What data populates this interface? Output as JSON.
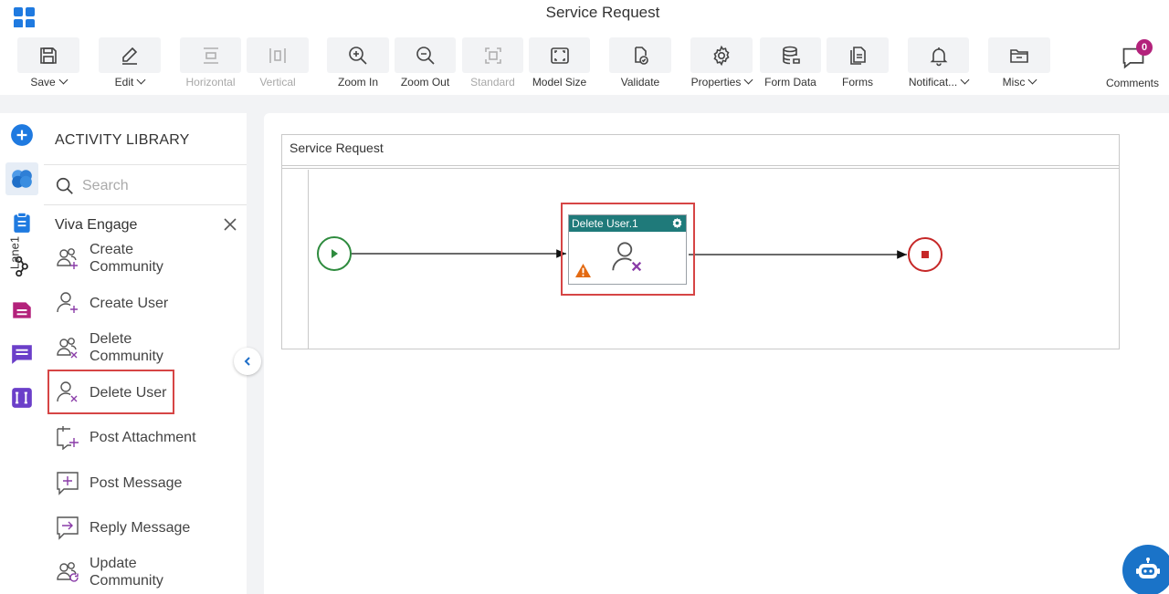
{
  "app": {
    "title": "Service Request"
  },
  "toolbar": {
    "save": "Save",
    "edit": "Edit",
    "horizontal": "Horizontal",
    "vertical": "Vertical",
    "zoom_in": "Zoom In",
    "zoom_out": "Zoom Out",
    "standard": "Standard",
    "model_size": "Model Size",
    "validate": "Validate",
    "properties": "Properties",
    "form_data": "Form Data",
    "forms": "Forms",
    "notifications": "Notificat...",
    "misc": "Misc",
    "comments": "Comments",
    "comments_count": "0"
  },
  "rail": {
    "icons": [
      "add-icon",
      "activity-library-icon",
      "clipboard-icon",
      "integration-icon",
      "form-icon",
      "message-icon",
      "text-icon"
    ]
  },
  "library": {
    "title": "ACTIVITY LIBRARY",
    "search_placeholder": "Search",
    "category": "Viva Engage",
    "items": [
      {
        "label": "Create Community",
        "icon": "create-community-icon"
      },
      {
        "label": "Create User",
        "icon": "create-user-icon"
      },
      {
        "label": "Delete Community",
        "icon": "delete-community-icon"
      },
      {
        "label": "Delete User",
        "icon": "delete-user-icon"
      },
      {
        "label": "Post Attachment",
        "icon": "post-attachment-icon"
      },
      {
        "label": "Post Message",
        "icon": "post-message-icon"
      },
      {
        "label": "Reply Message",
        "icon": "reply-message-icon"
      },
      {
        "label": "Update Community",
        "icon": "update-community-icon"
      }
    ]
  },
  "canvas": {
    "pool_title": "Service Request",
    "lane_label": "Lane1",
    "task_title": "Delete User.1"
  },
  "colors": {
    "accent": "#1f7ae0",
    "task_header": "#1f7a7a",
    "start_event": "#2e8b3e",
    "end_event": "#c62828",
    "highlight": "#d64545",
    "warning": "#e36a12",
    "icon_purple": "#8a3ca8",
    "badge": "#b3227b"
  }
}
